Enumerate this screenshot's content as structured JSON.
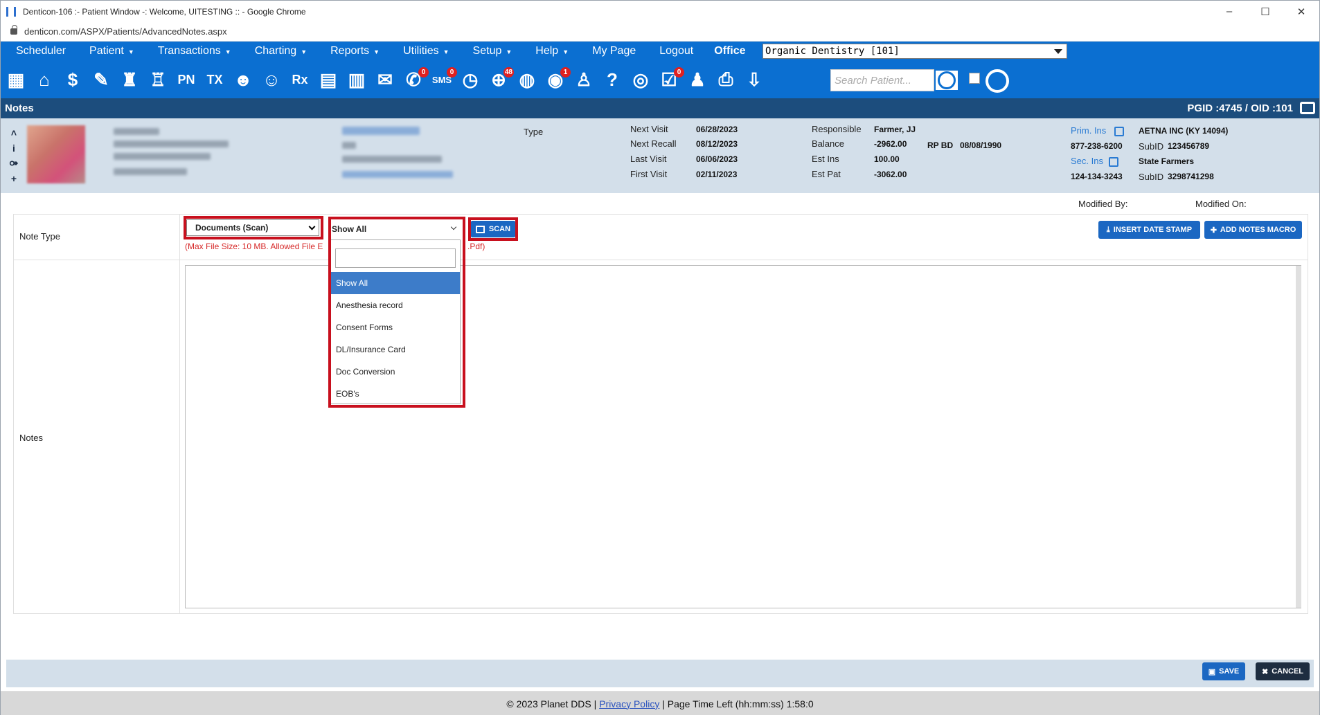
{
  "browser": {
    "title": "Denticon-106 :- Patient Window -: Welcome, UITESTING :: - Google Chrome",
    "url": "denticon.com/ASPX/Patients/AdvancedNotes.aspx"
  },
  "menu": {
    "items": [
      {
        "label": "Scheduler",
        "caret": false
      },
      {
        "label": "Patient",
        "caret": true
      },
      {
        "label": "Transactions",
        "caret": true
      },
      {
        "label": "Charting",
        "caret": true
      },
      {
        "label": "Reports",
        "caret": true
      },
      {
        "label": "Utilities",
        "caret": true
      },
      {
        "label": "Setup",
        "caret": true
      },
      {
        "label": "Help",
        "caret": true
      },
      {
        "label": "My Page",
        "caret": false
      },
      {
        "label": "Logout",
        "caret": false
      }
    ],
    "office_label": "Office",
    "office_value": "Organic Dentistry [101]"
  },
  "toolbar": {
    "icons": [
      {
        "name": "calendar-icon",
        "glyph": "▦"
      },
      {
        "name": "home-icon",
        "glyph": "⌂"
      },
      {
        "name": "dollar-icon",
        "glyph": "$"
      },
      {
        "name": "edit-chart-icon",
        "glyph": "✎"
      },
      {
        "name": "tooth-chart-icon",
        "glyph": "♜"
      },
      {
        "name": "perio-icon",
        "glyph": "♖"
      },
      {
        "name": "pn-icon",
        "text": "PN"
      },
      {
        "name": "tx-icon",
        "text": "TX"
      },
      {
        "name": "add-patient-icon",
        "glyph": "☻"
      },
      {
        "name": "add-family-icon",
        "glyph": "☺"
      },
      {
        "name": "rx-icon",
        "text": "Rx"
      },
      {
        "name": "notes-icon",
        "glyph": "▤"
      },
      {
        "name": "documents-icon",
        "glyph": "▥"
      },
      {
        "name": "mail-icon",
        "glyph": "✉"
      },
      {
        "name": "messages-icon",
        "glyph": "✆",
        "badge": "0"
      },
      {
        "name": "sms-icon",
        "text": "SMS",
        "badge": "0"
      },
      {
        "name": "clock-icon",
        "glyph": "◷"
      },
      {
        "name": "web-icon",
        "glyph": "⊕",
        "badge": "48"
      },
      {
        "name": "support-icon",
        "glyph": "◍"
      },
      {
        "name": "alerts-icon",
        "glyph": "◉",
        "badge": "1"
      },
      {
        "name": "tooth-icon",
        "glyph": "♙"
      },
      {
        "name": "tooth-question-icon",
        "glyph": "?"
      },
      {
        "name": "globe-search-icon",
        "glyph": "◎"
      },
      {
        "name": "forms-icon",
        "glyph": "☑",
        "badge": "0"
      },
      {
        "name": "family-icon",
        "glyph": "♟"
      },
      {
        "name": "print-icon",
        "glyph": "⎙"
      },
      {
        "name": "download-icon",
        "glyph": "⇩"
      }
    ],
    "search_placeholder": "Search Patient..."
  },
  "header": {
    "title": "Notes",
    "pgid": "PGID :4745  /  OID :101"
  },
  "patient": {
    "type_label": "Type",
    "visits": [
      {
        "label": "Next Visit",
        "value": "06/28/2023"
      },
      {
        "label": "Next Recall",
        "value": "08/12/2023"
      },
      {
        "label": "Last Visit",
        "value": "06/06/2023"
      },
      {
        "label": "First Visit",
        "value": "02/11/2023"
      }
    ],
    "financial": [
      {
        "label": "Responsible",
        "value": "Farmer, JJ"
      },
      {
        "label": "Balance",
        "value": "-2962.00"
      },
      {
        "label": "Est Ins",
        "value": "100.00"
      },
      {
        "label": "Est Pat",
        "value": "-3062.00"
      }
    ],
    "rp_bd_label": "RP BD",
    "rp_bd_value": "08/08/1990",
    "prim_ins_label": "Prim. Ins",
    "prim_ins_name": "AETNA INC (KY 14094)",
    "prim_ins_phone": "877-238-6200",
    "prim_subid_label": "SubID",
    "prim_subid": "123456789",
    "sec_ins_label": "Sec. Ins",
    "sec_ins_name": "State Farmers",
    "sec_ins_phone": "124-134-3243",
    "sec_subid_label": "SubID",
    "sec_subid": "3298741298"
  },
  "form": {
    "modified_by_label": "Modified By:",
    "modified_on_label": "Modified On:",
    "note_type_label": "Note Type",
    "note_type_value": "Documents (Scan)",
    "filter_value": "Show All",
    "hint": "(Max File Size: 10 MB. Allowed File E",
    "hint_tail": ".Pdf)",
    "scan_label": "SCAN",
    "insert_date_label": "INSERT DATE STAMP",
    "add_macro_label": "ADD NOTES MACRO",
    "notes_label": "Notes",
    "dropdown_options": [
      "Show All",
      "Anesthesia record",
      "Consent Forms",
      "DL/Insurance Card",
      "Doc Conversion",
      "EOB's"
    ],
    "save_label": "SAVE",
    "cancel_label": "CANCEL"
  },
  "footer": {
    "copyright": "© 2023 Planet DDS |",
    "privacy": "Privacy Policy",
    "page_time": "| Page Time Left (hh:mm:ss) 1:58:0"
  },
  "colors": {
    "nav_blue": "#0b6fd1",
    "header_navy": "#1c4d7d",
    "highlight_red": "#c8101e",
    "patient_bg": "#d3dfea"
  }
}
